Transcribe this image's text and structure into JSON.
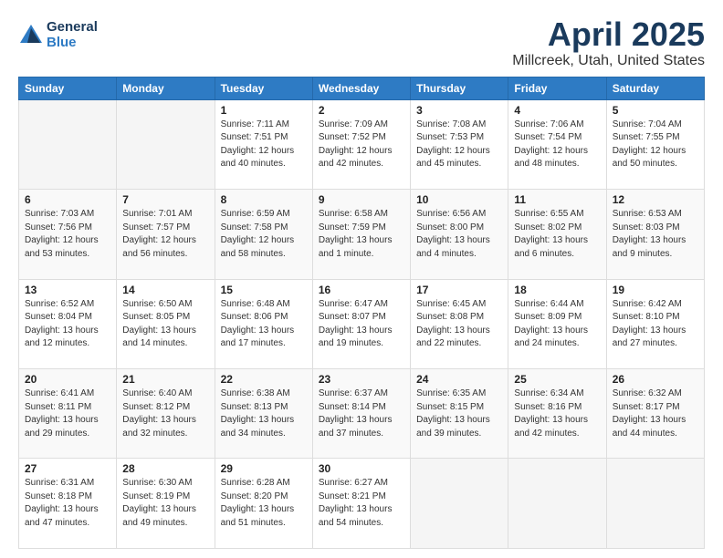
{
  "logo": {
    "general": "General",
    "blue": "Blue"
  },
  "title": "April 2025",
  "subtitle": "Millcreek, Utah, United States",
  "days_of_week": [
    "Sunday",
    "Monday",
    "Tuesday",
    "Wednesday",
    "Thursday",
    "Friday",
    "Saturday"
  ],
  "weeks": [
    [
      {
        "day": "",
        "info": ""
      },
      {
        "day": "",
        "info": ""
      },
      {
        "day": "1",
        "info": "Sunrise: 7:11 AM\nSunset: 7:51 PM\nDaylight: 12 hours\nand 40 minutes."
      },
      {
        "day": "2",
        "info": "Sunrise: 7:09 AM\nSunset: 7:52 PM\nDaylight: 12 hours\nand 42 minutes."
      },
      {
        "day": "3",
        "info": "Sunrise: 7:08 AM\nSunset: 7:53 PM\nDaylight: 12 hours\nand 45 minutes."
      },
      {
        "day": "4",
        "info": "Sunrise: 7:06 AM\nSunset: 7:54 PM\nDaylight: 12 hours\nand 48 minutes."
      },
      {
        "day": "5",
        "info": "Sunrise: 7:04 AM\nSunset: 7:55 PM\nDaylight: 12 hours\nand 50 minutes."
      }
    ],
    [
      {
        "day": "6",
        "info": "Sunrise: 7:03 AM\nSunset: 7:56 PM\nDaylight: 12 hours\nand 53 minutes."
      },
      {
        "day": "7",
        "info": "Sunrise: 7:01 AM\nSunset: 7:57 PM\nDaylight: 12 hours\nand 56 minutes."
      },
      {
        "day": "8",
        "info": "Sunrise: 6:59 AM\nSunset: 7:58 PM\nDaylight: 12 hours\nand 58 minutes."
      },
      {
        "day": "9",
        "info": "Sunrise: 6:58 AM\nSunset: 7:59 PM\nDaylight: 13 hours\nand 1 minute."
      },
      {
        "day": "10",
        "info": "Sunrise: 6:56 AM\nSunset: 8:00 PM\nDaylight: 13 hours\nand 4 minutes."
      },
      {
        "day": "11",
        "info": "Sunrise: 6:55 AM\nSunset: 8:02 PM\nDaylight: 13 hours\nand 6 minutes."
      },
      {
        "day": "12",
        "info": "Sunrise: 6:53 AM\nSunset: 8:03 PM\nDaylight: 13 hours\nand 9 minutes."
      }
    ],
    [
      {
        "day": "13",
        "info": "Sunrise: 6:52 AM\nSunset: 8:04 PM\nDaylight: 13 hours\nand 12 minutes."
      },
      {
        "day": "14",
        "info": "Sunrise: 6:50 AM\nSunset: 8:05 PM\nDaylight: 13 hours\nand 14 minutes."
      },
      {
        "day": "15",
        "info": "Sunrise: 6:48 AM\nSunset: 8:06 PM\nDaylight: 13 hours\nand 17 minutes."
      },
      {
        "day": "16",
        "info": "Sunrise: 6:47 AM\nSunset: 8:07 PM\nDaylight: 13 hours\nand 19 minutes."
      },
      {
        "day": "17",
        "info": "Sunrise: 6:45 AM\nSunset: 8:08 PM\nDaylight: 13 hours\nand 22 minutes."
      },
      {
        "day": "18",
        "info": "Sunrise: 6:44 AM\nSunset: 8:09 PM\nDaylight: 13 hours\nand 24 minutes."
      },
      {
        "day": "19",
        "info": "Sunrise: 6:42 AM\nSunset: 8:10 PM\nDaylight: 13 hours\nand 27 minutes."
      }
    ],
    [
      {
        "day": "20",
        "info": "Sunrise: 6:41 AM\nSunset: 8:11 PM\nDaylight: 13 hours\nand 29 minutes."
      },
      {
        "day": "21",
        "info": "Sunrise: 6:40 AM\nSunset: 8:12 PM\nDaylight: 13 hours\nand 32 minutes."
      },
      {
        "day": "22",
        "info": "Sunrise: 6:38 AM\nSunset: 8:13 PM\nDaylight: 13 hours\nand 34 minutes."
      },
      {
        "day": "23",
        "info": "Sunrise: 6:37 AM\nSunset: 8:14 PM\nDaylight: 13 hours\nand 37 minutes."
      },
      {
        "day": "24",
        "info": "Sunrise: 6:35 AM\nSunset: 8:15 PM\nDaylight: 13 hours\nand 39 minutes."
      },
      {
        "day": "25",
        "info": "Sunrise: 6:34 AM\nSunset: 8:16 PM\nDaylight: 13 hours\nand 42 minutes."
      },
      {
        "day": "26",
        "info": "Sunrise: 6:32 AM\nSunset: 8:17 PM\nDaylight: 13 hours\nand 44 minutes."
      }
    ],
    [
      {
        "day": "27",
        "info": "Sunrise: 6:31 AM\nSunset: 8:18 PM\nDaylight: 13 hours\nand 47 minutes."
      },
      {
        "day": "28",
        "info": "Sunrise: 6:30 AM\nSunset: 8:19 PM\nDaylight: 13 hours\nand 49 minutes."
      },
      {
        "day": "29",
        "info": "Sunrise: 6:28 AM\nSunset: 8:20 PM\nDaylight: 13 hours\nand 51 minutes."
      },
      {
        "day": "30",
        "info": "Sunrise: 6:27 AM\nSunset: 8:21 PM\nDaylight: 13 hours\nand 54 minutes."
      },
      {
        "day": "",
        "info": ""
      },
      {
        "day": "",
        "info": ""
      },
      {
        "day": "",
        "info": ""
      }
    ]
  ]
}
